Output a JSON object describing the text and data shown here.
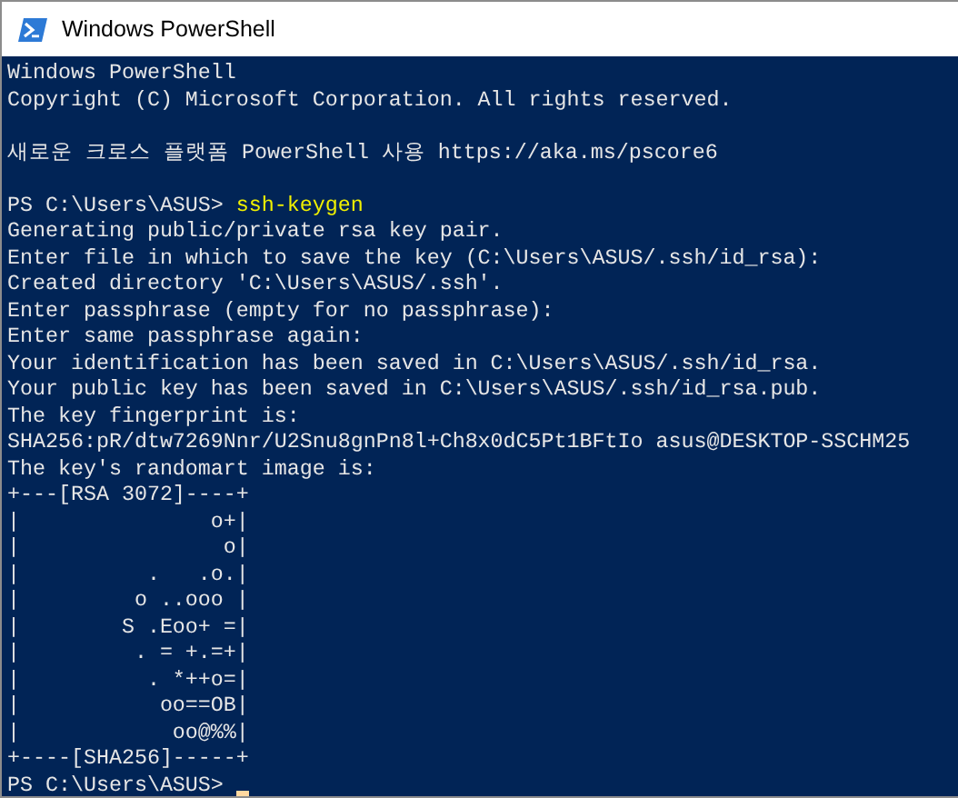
{
  "window": {
    "title": "Windows PowerShell"
  },
  "console": {
    "lines": [
      {
        "kind": "output",
        "text": "Windows PowerShell"
      },
      {
        "kind": "output",
        "text": "Copyright (C) Microsoft Corporation. All rights reserved."
      },
      {
        "kind": "blank"
      },
      {
        "kind": "output",
        "text": "새로운 크로스 플랫폼 PowerShell 사용 https://aka.ms/pscore6"
      },
      {
        "kind": "blank"
      },
      {
        "kind": "prompt",
        "prompt": "PS C:\\Users\\ASUS>",
        "command": "ssh-keygen",
        "cursor": false
      },
      {
        "kind": "output",
        "text": "Generating public/private rsa key pair."
      },
      {
        "kind": "output",
        "text": "Enter file in which to save the key (C:\\Users\\ASUS/.ssh/id_rsa):"
      },
      {
        "kind": "output",
        "text": "Created directory 'C:\\Users\\ASUS/.ssh'."
      },
      {
        "kind": "output",
        "text": "Enter passphrase (empty for no passphrase):"
      },
      {
        "kind": "output",
        "text": "Enter same passphrase again:"
      },
      {
        "kind": "output",
        "text": "Your identification has been saved in C:\\Users\\ASUS/.ssh/id_rsa."
      },
      {
        "kind": "output",
        "text": "Your public key has been saved in C:\\Users\\ASUS/.ssh/id_rsa.pub."
      },
      {
        "kind": "output",
        "text": "The key fingerprint is:"
      },
      {
        "kind": "output",
        "text": "SHA256:pR/dtw7269Nnr/U2Snu8gnPn8l+Ch8x0dC5Pt1BFtIo asus@DESKTOP-SSCHM25"
      },
      {
        "kind": "output",
        "text": "The key's randomart image is:"
      },
      {
        "kind": "output",
        "text": "+---[RSA 3072]----+"
      },
      {
        "kind": "output",
        "text": "|               o+|"
      },
      {
        "kind": "output",
        "text": "|                o|"
      },
      {
        "kind": "output",
        "text": "|          .   .o.|"
      },
      {
        "kind": "output",
        "text": "|         o ..ooo |"
      },
      {
        "kind": "output",
        "text": "|        S .Eoo+ =|"
      },
      {
        "kind": "output",
        "text": "|         . = +.=+|"
      },
      {
        "kind": "output",
        "text": "|          . *++o=|"
      },
      {
        "kind": "output",
        "text": "|           oo==OB|"
      },
      {
        "kind": "output",
        "text": "|            oo@%%|"
      },
      {
        "kind": "output",
        "text": "+----[SHA256]-----+"
      },
      {
        "kind": "prompt",
        "prompt": "PS C:\\Users\\ASUS>",
        "cursor": true
      }
    ]
  }
}
